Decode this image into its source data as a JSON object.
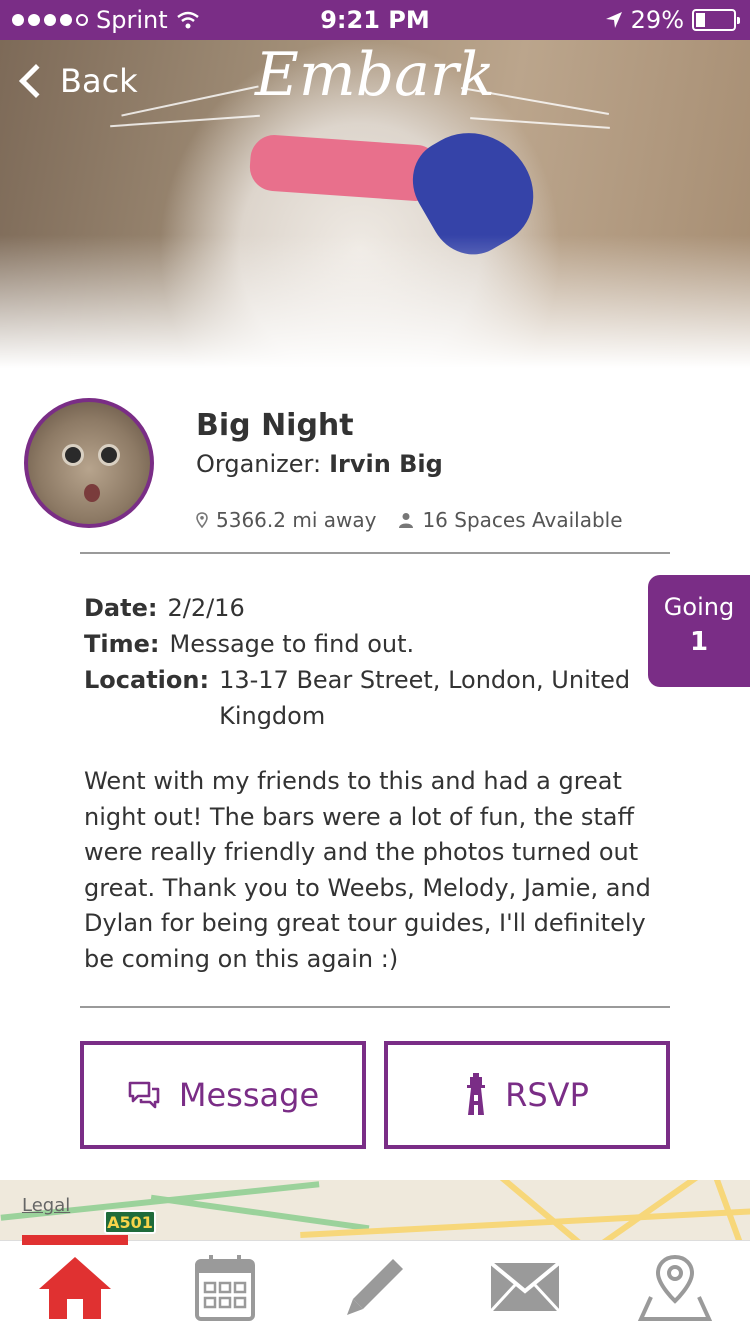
{
  "status_bar": {
    "carrier": "Sprint",
    "time": "9:21 PM",
    "battery": "29%",
    "signal_dots_filled": 4,
    "signal_dots_total": 5
  },
  "header": {
    "back_label": "Back",
    "brand": "Embark"
  },
  "event": {
    "title": "Big Night",
    "organizer_label": "Organizer:",
    "organizer_name": "Irvin Big",
    "distance": "5366.2 mi away",
    "spaces": "16 Spaces Available",
    "going_label": "Going",
    "going_count": "1",
    "date_label": "Date:",
    "date_value": "2/2/16",
    "time_label": "Time:",
    "time_value": "Message to find out.",
    "location_label": "Location:",
    "location_value": "13-17 Bear Street, London, United Kingdom",
    "description": "Went with my friends to this and had a great night out! The bars were a lot of fun, the staff were really friendly and the photos turned out great. Thank you to Weebs, Melody, Jamie, and Dylan for being great tour guides, I'll definitely be coming on this again :)"
  },
  "actions": {
    "message_label": "Message",
    "rsvp_label": "RSVP"
  },
  "map": {
    "legal": "Legal",
    "road_sign": "A501"
  },
  "tabs": {
    "items": [
      "home-icon",
      "calendar-icon",
      "pencil-icon",
      "mail-icon",
      "map-pin-icon"
    ],
    "active_index": 0
  },
  "colors": {
    "brand": "#7a2d86",
    "active_tab": "#e03131",
    "inactive_icon": "#9a9a9a"
  }
}
